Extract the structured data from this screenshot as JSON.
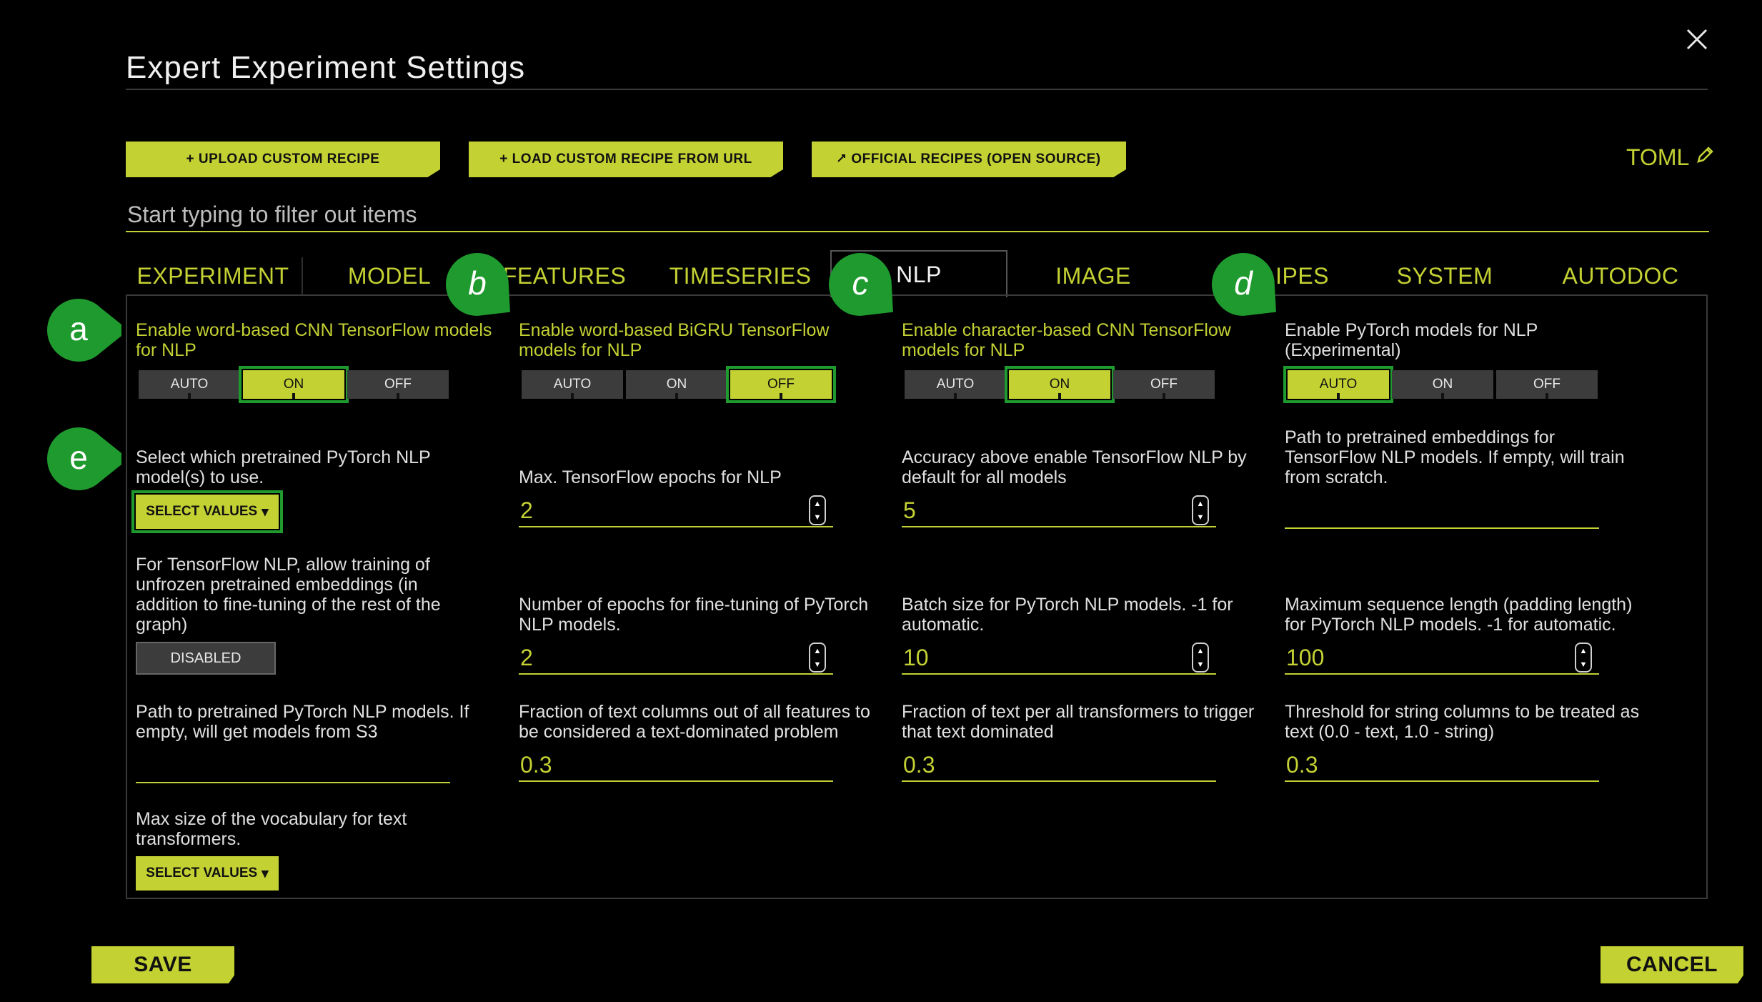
{
  "dialog": {
    "title": "Expert Experiment Settings"
  },
  "toolbar": {
    "upload": "+ UPLOAD CUSTOM RECIPE",
    "load_url": "+ LOAD CUSTOM RECIPE FROM URL",
    "official": "OFFICIAL RECIPES (OPEN SOURCE)",
    "toml": "TOML"
  },
  "filter": {
    "placeholder": "Start typing to filter out items"
  },
  "tabs": [
    "EXPERIMENT",
    "MODEL",
    "FEATURES",
    "TIMESERIES",
    "NLP",
    "IMAGE",
    "RECIPES",
    "SYSTEM",
    "AUTODOC"
  ],
  "tab_visible_labels": [
    "EXPERIMENT",
    "MODEL",
    "FEATURES",
    "TIMESERIES",
    "NLP",
    "IMAGE",
    "IPES",
    "SYSTEM",
    "AUTODOC"
  ],
  "active_tab": "NLP",
  "markers": [
    "a",
    "b",
    "c",
    "d",
    "e"
  ],
  "toggle_options": [
    "AUTO",
    "ON",
    "OFF"
  ],
  "settings": {
    "cnn_word": {
      "label": "Enable word-based CNN TensorFlow models for NLP",
      "value": "ON"
    },
    "bigru_word": {
      "label": "Enable word-based BiGRU TensorFlow models for NLP",
      "value": "OFF"
    },
    "cnn_char": {
      "label": "Enable character-based CNN TensorFlow models for NLP",
      "value": "ON"
    },
    "pytorch": {
      "label": "Enable PyTorch models for NLP (Experimental)",
      "value": "AUTO"
    },
    "pretrained_pytorch": {
      "label": "Select which pretrained PyTorch NLP model(s) to use.",
      "button": "SELECT VALUES"
    },
    "tf_epochs": {
      "label": "Max. TensorFlow epochs for NLP",
      "value": "2"
    },
    "accuracy_enable": {
      "label": "Accuracy above enable TensorFlow NLP by default for all models",
      "value": "5"
    },
    "embeddings_path": {
      "label": "Path to pretrained embeddings for TensorFlow NLP models. If empty, will train from scratch.",
      "value": ""
    },
    "unfrozen": {
      "label": "For TensorFlow NLP, allow training of unfrozen pretrained embeddings (in addition to fine-tuning of the rest of the graph)",
      "button": "DISABLED"
    },
    "finetune_epochs": {
      "label": "Number of epochs for fine-tuning of PyTorch NLP models.",
      "value": "2"
    },
    "batch_size": {
      "label": "Batch size for PyTorch NLP models. -1 for automatic.",
      "value": "10"
    },
    "max_seq": {
      "label": "Maximum sequence length (padding length) for PyTorch NLP models. -1 for automatic.",
      "value": "100"
    },
    "pytorch_path": {
      "label": "Path to pretrained PyTorch NLP models. If empty, will get models from S3",
      "value": ""
    },
    "text_fraction": {
      "label": "Fraction of text columns out of all features to be considered a text-dominated problem",
      "value": "0.3"
    },
    "transformer_fraction": {
      "label": "Fraction of text per all transformers to trigger that text dominated",
      "value": "0.3"
    },
    "string_threshold": {
      "label": "Threshold for string columns to be treated as text (0.0 - text, 1.0 - string)",
      "value": "0.3"
    },
    "vocab_size": {
      "label": "Max size of the vocabulary for text transformers.",
      "button": "SELECT VALUES"
    }
  },
  "footer": {
    "save": "SAVE",
    "cancel": "CANCEL"
  },
  "colors": {
    "accent": "#c3d133",
    "marker": "#1f9a2e",
    "background": "#000000"
  }
}
